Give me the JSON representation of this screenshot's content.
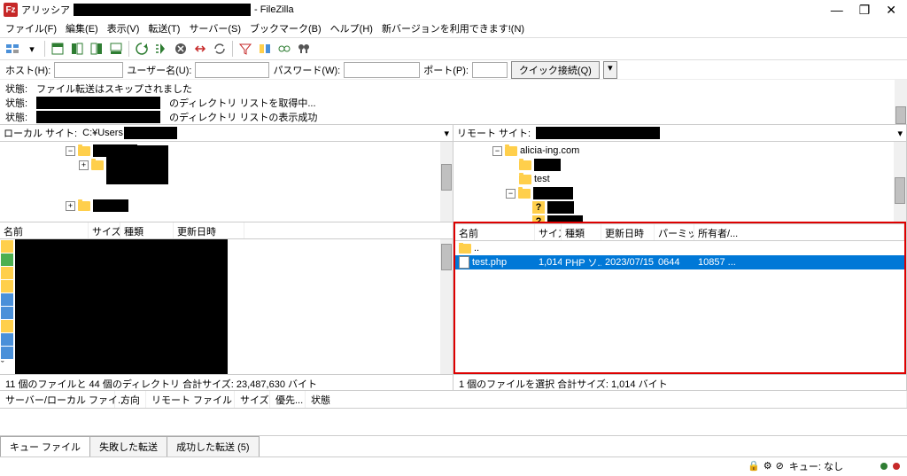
{
  "title": {
    "prefix": "アリッシア",
    "suffix": "- FileZilla"
  },
  "window_buttons": {
    "min": "—",
    "max": "❐",
    "close": "✕"
  },
  "menu": [
    "ファイル(F)",
    "編集(E)",
    "表示(V)",
    "転送(T)",
    "サーバー(S)",
    "ブックマーク(B)",
    "ヘルプ(H)",
    "新バージョンを利用できます!(N)"
  ],
  "quickconnect": {
    "host_label": "ホスト(H):",
    "user_label": "ユーザー名(U):",
    "pass_label": "パスワード(W):",
    "port_label": "ポート(P):",
    "button": "クイック接続(Q)",
    "drop": "▾"
  },
  "log": {
    "label": "状態:",
    "l1": "ファイル転送はスキップされました",
    "l2_suffix": "のディレクトリ リストを取得中...",
    "l3_suffix": "のディレクトリ リストの表示成功"
  },
  "local": {
    "label": "ローカル サイト:",
    "path_prefix": "C:¥Users",
    "headers": {
      "name": "名前",
      "size": "サイズ",
      "type": "種類",
      "date": "更新日時"
    },
    "status": "11 個のファイルと 44 個のディレクトリ 合計サイズ: 23,487,630 バイト"
  },
  "remote": {
    "label": "リモート サイト:",
    "tree": {
      "n1": "alicia-ing.com",
      "n2": "test"
    },
    "headers": {
      "name": "名前",
      "size": "サイズ",
      "type": "種類",
      "date": "更新日時",
      "perm": "パーミッ...",
      "owner": "所有者/..."
    },
    "parent_dir": "..",
    "file": {
      "name": "test.php",
      "size": "1,014",
      "type": "PHP ソ...",
      "date": "2023/07/15 ...",
      "perm": "0644",
      "owner": "10857 ..."
    },
    "status": "1 個のファイルを選択 合計サイズ: 1,014 バイト"
  },
  "transfer": {
    "headers": [
      "サーバー/ローカル ファイ...",
      "方向",
      "リモート ファイル",
      "サイズ",
      "優先...",
      "状態"
    ],
    "tabs": {
      "queue": "キュー ファイル",
      "failed": "失敗した転送",
      "success": "成功した転送 (5)"
    }
  },
  "statusbar": {
    "queue": "キュー: なし"
  },
  "tree_symbols": {
    "plus": "+",
    "minus": "−",
    "q": "?"
  }
}
